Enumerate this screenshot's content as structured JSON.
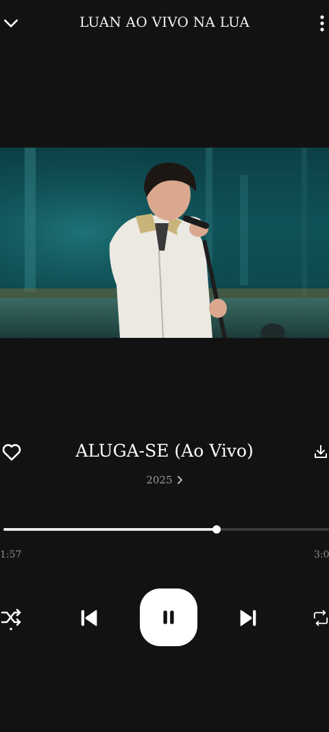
{
  "header": {
    "title": "LUAN AO VIVO NA LUA",
    "collapse_icon": "chevron-down-icon",
    "menu_icon": "more-vertical-icon"
  },
  "song": {
    "title": "ALUGA-SE (Ao Vivo)",
    "year": "2025"
  },
  "progress": {
    "elapsed": "1:57",
    "total": "3:0",
    "fraction": 0.655
  },
  "controls": {
    "shuffle_icon": "shuffle-icon",
    "previous_icon": "skip-previous-icon",
    "pause_icon": "pause-icon",
    "next_icon": "skip-next-icon",
    "repeat_icon": "repeat-icon",
    "like_icon": "heart-icon",
    "download_icon": "download-icon"
  },
  "colors": {
    "background": "#121212",
    "text": "#ffffff",
    "muted": "#8e8e8e",
    "track": "#3a3a3a",
    "fill": "#e9e9e9"
  }
}
